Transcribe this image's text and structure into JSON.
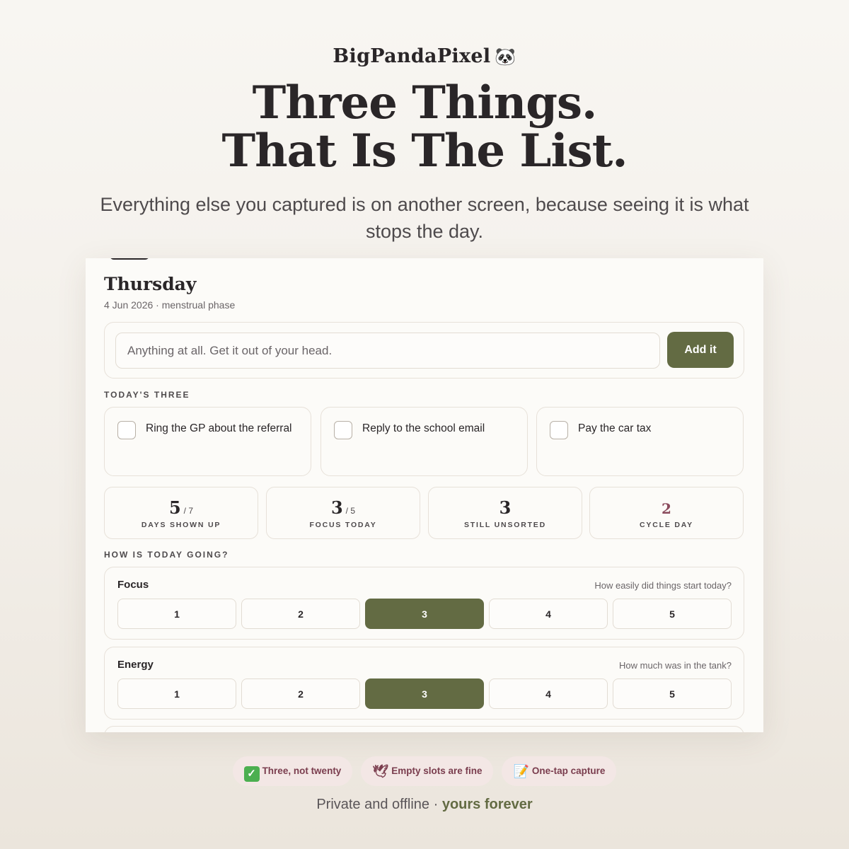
{
  "brand": {
    "name": "BigPandaPixel",
    "emoji": "🐼"
  },
  "hero": {
    "headline_line1": "Three Things.",
    "headline_line2": "That Is The List.",
    "subhead": "Everything else you captured is on another screen, because seeing it is what stops the day."
  },
  "app": {
    "day": "Thursday",
    "date_line": "4 Jun 2026 · menstrual phase",
    "capture": {
      "placeholder": "Anything at all. Get it out of your head.",
      "value": "",
      "button": "Add it"
    },
    "todays_three_label": "TODAY'S THREE",
    "tasks": [
      {
        "label": "Ring the GP about the referral",
        "done": false
      },
      {
        "label": "Reply to the school email",
        "done": false
      },
      {
        "label": "Pay the car tax",
        "done": false
      }
    ],
    "stats": [
      {
        "value": "5",
        "denominator": "/ 7",
        "caption": "DAYS SHOWN UP"
      },
      {
        "value": "3",
        "denominator": "/ 5",
        "caption": "FOCUS TODAY"
      },
      {
        "value": "3",
        "denominator": "",
        "caption": "STILL UNSORTED"
      },
      {
        "value": "2",
        "denominator": "",
        "caption": "CYCLE DAY",
        "accent": "#8a4a5c"
      }
    ],
    "how_going_label": "HOW IS TODAY GOING?",
    "ratings": [
      {
        "name": "Focus",
        "question": "How easily did things start today?",
        "options": [
          "1",
          "2",
          "3",
          "4",
          "5"
        ],
        "selected": 3
      },
      {
        "name": "Energy",
        "question": "How much was in the tank?",
        "options": [
          "1",
          "2",
          "3",
          "4",
          "5"
        ],
        "selected": 3
      }
    ]
  },
  "pills": [
    {
      "icon": "check-mark-icon",
      "label": "Three, not twenty"
    },
    {
      "icon": "dove-icon",
      "label": "Empty slots are fine"
    },
    {
      "icon": "memo-icon",
      "label": "One-tap capture"
    }
  ],
  "footer": {
    "text": "Private and offline · ",
    "emphasis": "yours forever"
  },
  "colors": {
    "accent": "#636b43",
    "pill_bg": "#f3e7e5",
    "pill_text": "#7a3d4e",
    "cycle_accent": "#8a4a5c"
  }
}
